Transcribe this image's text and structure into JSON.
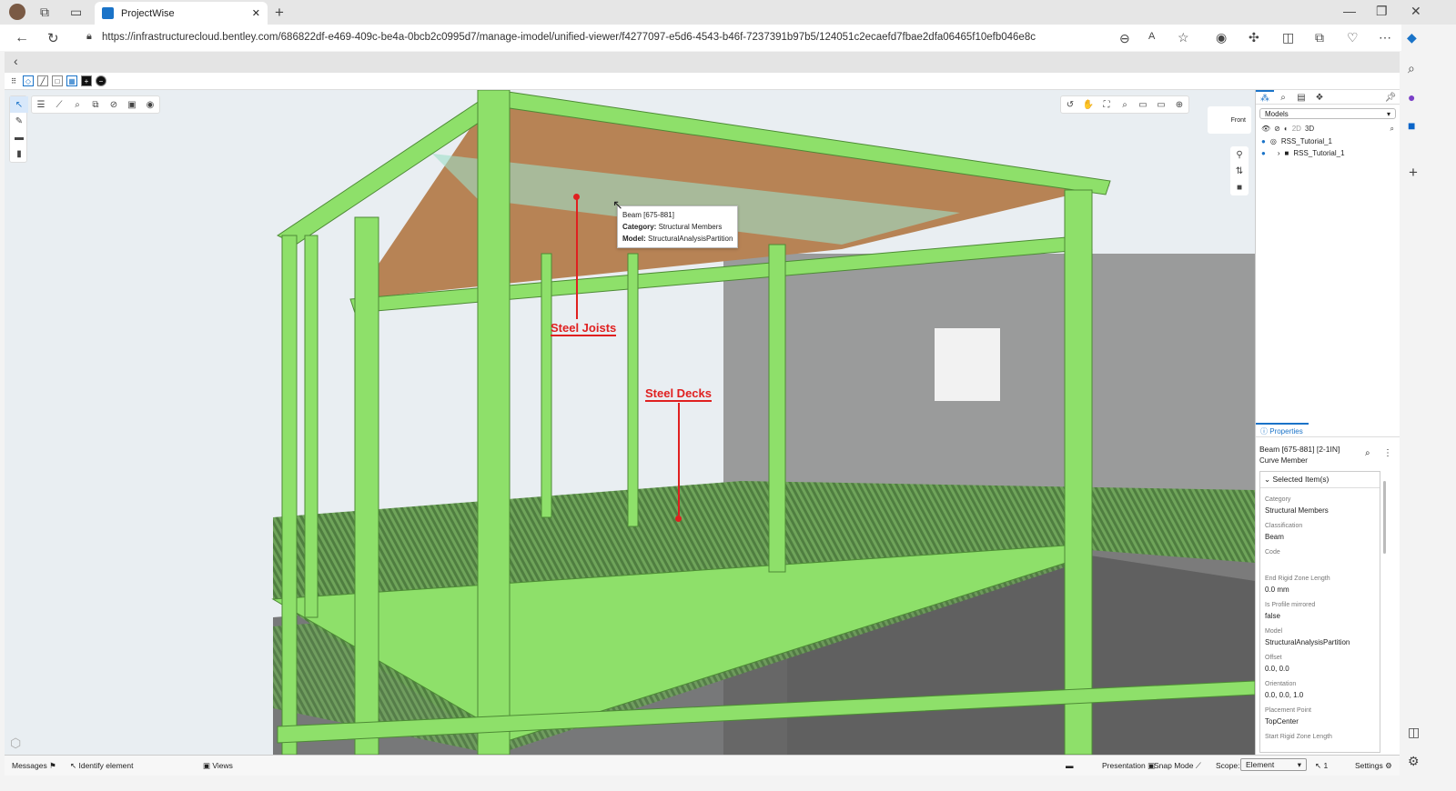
{
  "browser": {
    "tab_title": "ProjectWise",
    "url": "https://infrastructurecloud.bentley.com/686822df-e469-409c-be4a-0bcb2c0995d7/manage-imodel/unified-viewer/f4277097-e5d6-4543-b46f-7237391b97b5/124051c2ecaefd7fbae2dfa06465f10efb046e8c"
  },
  "viewport": {
    "view_cube_label": "Front",
    "tooltip": {
      "title": "Beam [675-881]",
      "category_label": "Category:",
      "category": "Structural Members",
      "model_label": "Model:",
      "model": "StructuralAnalysisPartition"
    },
    "annotations": [
      "Steel Joists",
      "Steel Decks"
    ]
  },
  "model_tree": {
    "dropdown": "Models",
    "filter_2d": "2D",
    "filter_3d": "3D",
    "items": [
      {
        "label": "RSS_Tutorial_1"
      },
      {
        "label": "RSS_Tutorial_1"
      }
    ]
  },
  "properties": {
    "tab": "Properties",
    "title": "Beam [675-881] [2-1IN]",
    "subtitle": "Curve Member",
    "section": "Selected Item(s)",
    "rows": [
      {
        "label": "Category",
        "value": "Structural Members"
      },
      {
        "label": "Classification",
        "value": "Beam"
      },
      {
        "label": "Code",
        "value": ""
      },
      {
        "label": "End Rigid Zone Length",
        "value": "0.0 mm"
      },
      {
        "label": "Is Profile mirrored",
        "value": "false"
      },
      {
        "label": "Model",
        "value": "StructuralAnalysisPartition"
      },
      {
        "label": "Offset",
        "value": "0.0, 0.0"
      },
      {
        "label": "Orientation",
        "value": "0.0, 0.0, 1.0"
      },
      {
        "label": "Placement Point",
        "value": "TopCenter"
      },
      {
        "label": "Start Rigid Zone Length",
        "value": ""
      }
    ]
  },
  "statusbar": {
    "messages": "Messages",
    "identify": "Identify element",
    "views": "Views",
    "presentation": "Presentation",
    "snap_mode": "Snap Mode",
    "scope_label": "Scope:",
    "scope_value": "Element",
    "selection_count": "1",
    "settings": "Settings"
  }
}
